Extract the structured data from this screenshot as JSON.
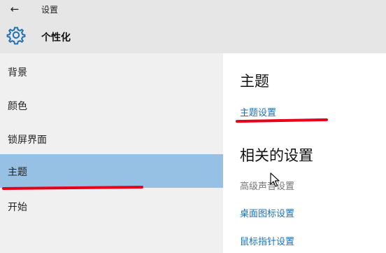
{
  "titlebar": {
    "title": "设置"
  },
  "header": {
    "title": "个性化"
  },
  "sidebar": {
    "items": [
      {
        "label": "背景"
      },
      {
        "label": "颜色"
      },
      {
        "label": "锁屏界面"
      },
      {
        "label": "主题",
        "selected": true
      },
      {
        "label": "开始"
      }
    ]
  },
  "content": {
    "theme_heading": "主题",
    "theme_settings_link": "主题设置",
    "related_heading": "相关的设置",
    "advanced_sound": "高级声音设置",
    "desktop_icons_link": "桌面图标设置",
    "mouse_pointer_link": "鼠标指针设置"
  },
  "colors": {
    "selected": "#96c1e4",
    "link": "#1f6fb2",
    "annotation": "#e8001a"
  },
  "icons": {
    "back": "back-arrow-icon",
    "settings": "gear-icon",
    "cursor": "mouse-cursor-icon"
  }
}
